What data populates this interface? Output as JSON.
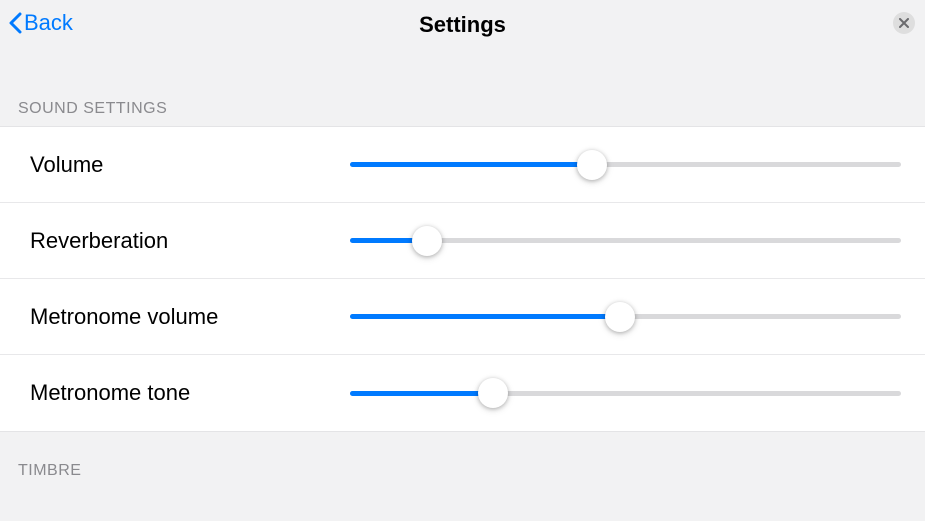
{
  "header": {
    "back_label": "Back",
    "title": "Settings"
  },
  "sections": {
    "sound": {
      "title": "Sound Settings",
      "items": [
        {
          "label": "Volume",
          "value": 44
        },
        {
          "label": "Reverberation",
          "value": 14
        },
        {
          "label": "Metronome volume",
          "value": 49
        },
        {
          "label": "Metronome tone",
          "value": 26
        }
      ]
    },
    "timbre": {
      "title": "Timbre"
    }
  },
  "colors": {
    "accent": "#007aff",
    "background": "#f2f2f3"
  }
}
